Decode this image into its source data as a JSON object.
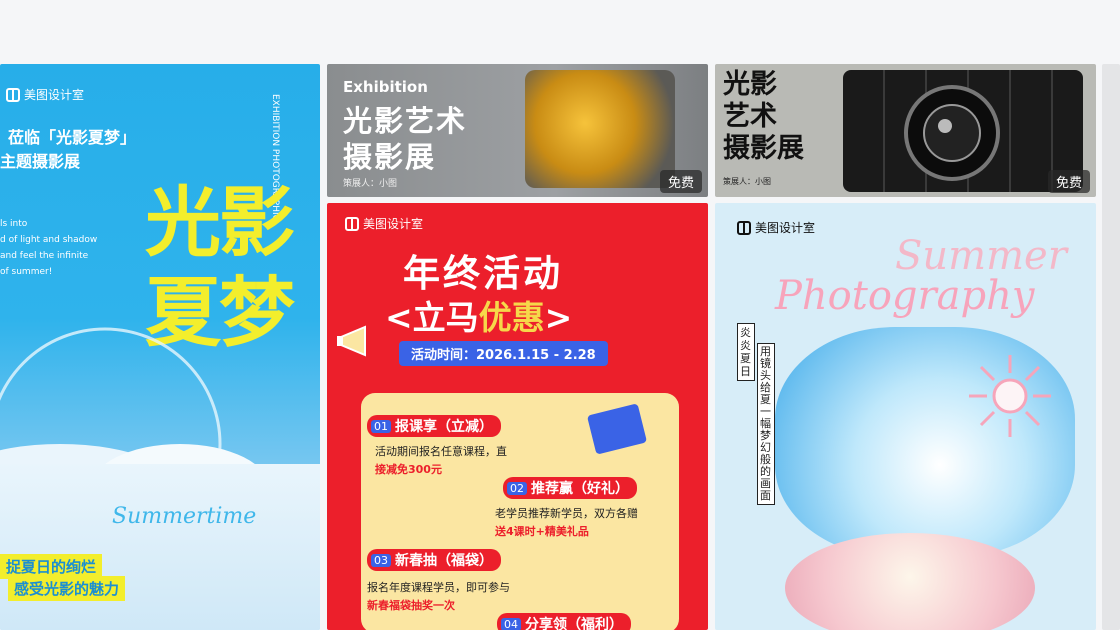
{
  "cards": {
    "card1": {
      "logo": "美图设计室",
      "line1": "莅临「光影夏梦」",
      "line2": "主题摄影展",
      "vertical_en": "EXHIBITION PHOTOGRAPHIC",
      "en_small": "ls into\nd of light and shadow\nand feel the infinite\nof summer!",
      "big_title_1": "光影",
      "big_title_2": "夏梦",
      "script": "Summertime",
      "bottom_1": "捉夏日的绚烂",
      "bottom_2": "感受光影的魅力"
    },
    "card2": {
      "en": "Exhibition",
      "title_1": "光影艺术",
      "title_2": "摄影展",
      "planner": "策展人：小图",
      "badge": "免费"
    },
    "card3": {
      "title_1": "光影",
      "title_2": "艺术",
      "title_3": "摄影展",
      "planner": "策展人：小图",
      "badge": "免费"
    },
    "card4": {
      "logo": "美图设计室",
      "title": "年终活动",
      "subtitle_1": "<立马",
      "subtitle_2": "优惠",
      "subtitle_3": ">",
      "time": "活动时间：2026.1.15 - 2.28",
      "i1_num": "01",
      "i1_title": "报课享（立减）",
      "i1_desc_1": "活动期间报名任意课程，直",
      "i1_desc_2": "接减免300元",
      "i2_num": "02",
      "i2_title": "推荐赢（好礼）",
      "i2_desc_1": "老学员推荐新学员，双方各赠",
      "i2_desc_2": "送4课时+精美礼品",
      "i3_num": "03",
      "i3_title": "新春抽（福袋）",
      "i3_desc_1": "报名年度课程学员，即可参与",
      "i3_desc_2": "新春福袋抽奖一次",
      "i4_num": "04",
      "i4_title": "分享领（福利）"
    },
    "card5": {
      "logo": "美图设计室",
      "script_1": "Summer",
      "script_2": "Photography",
      "vert_1": "炎炎夏日",
      "vert_2": "用镜头给夏一幅梦幻般的画面"
    }
  },
  "colors": {
    "blue": "#2ab0eb",
    "yellow": "#f3ee2c",
    "red": "#ec1f2b",
    "cream": "#fbe6a2"
  }
}
